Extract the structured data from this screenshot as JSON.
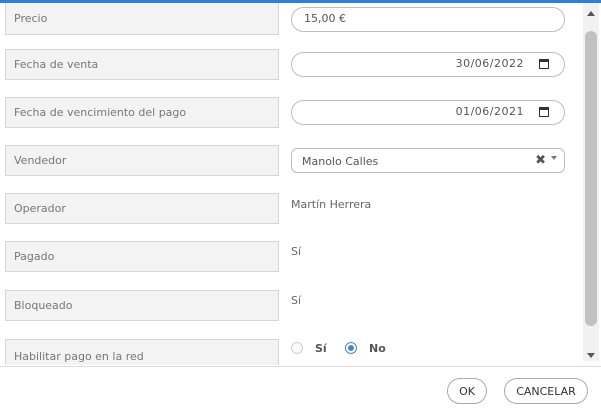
{
  "fields": {
    "precio": {
      "label": "Precio",
      "value": "15,00 €"
    },
    "fecha_venta": {
      "label": "Fecha de venta",
      "value": "30/06/2022"
    },
    "fecha_vencimiento": {
      "label": "Fecha de vencimiento del pago",
      "value": "01/06/2021"
    },
    "vendedor": {
      "label": "Vendedor",
      "value": "Manolo Calles",
      "clear_glyph": "✖"
    },
    "operador": {
      "label": "Operador",
      "value": "Martín Herrera"
    },
    "pagado": {
      "label": "Pagado",
      "value": "Sí"
    },
    "bloqueado": {
      "label": "Bloqueado",
      "value": "Sí"
    },
    "habilitar_pago": {
      "label": "Habilitar pago en la red",
      "option_yes": "Sí",
      "option_no": "No",
      "selected": "No"
    }
  },
  "footer": {
    "ok_label": "OK",
    "cancel_label": "CANCELAR"
  },
  "colors": {
    "accent": "#2f7fd6",
    "radio_selected": "#4a86c8"
  }
}
